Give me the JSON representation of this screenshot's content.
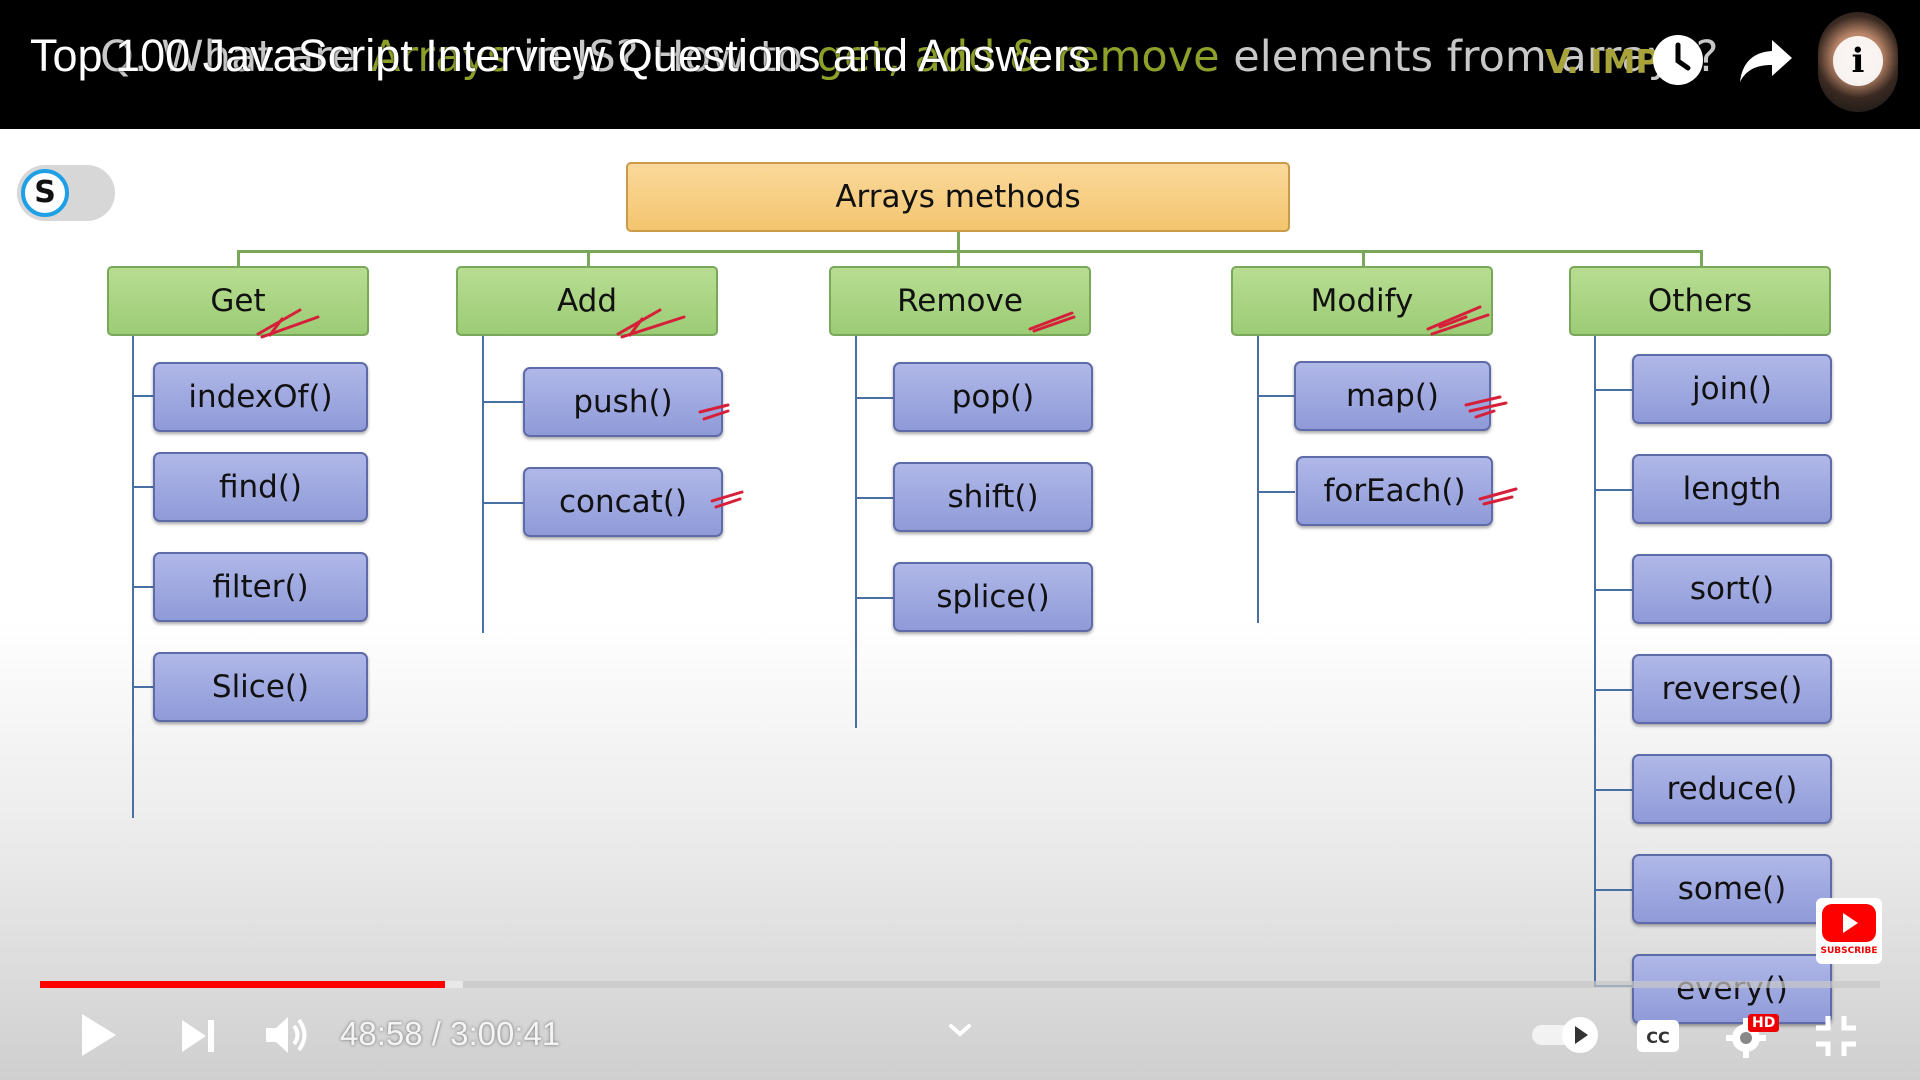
{
  "video": {
    "title": "Top 100 JavaScript Interview Questions and Answers",
    "time_current": "48:58",
    "time_separator": " / ",
    "time_total": "3:00:41",
    "progress_played": 0.22,
    "progress_loaded": 0.23
  },
  "slide": {
    "question_prefix": "Q. What are ",
    "question_hl1": "Arrays",
    "question_mid": " in JS? How to ",
    "question_hl2": "get, add & remove",
    "question_suffix": " elements from arrays?",
    "tag": "V. IMP.",
    "toggle_letter": "S"
  },
  "diagram": {
    "root": "Arrays methods",
    "categories": [
      {
        "label": "Get",
        "methods": [
          "indexOf()",
          "find()",
          "filter()",
          "Slice()"
        ]
      },
      {
        "label": "Add",
        "methods": [
          "push()",
          "concat()"
        ]
      },
      {
        "label": "Remove",
        "methods": [
          "pop()",
          "shift()",
          "splice()"
        ]
      },
      {
        "label": "Modify",
        "methods": [
          "map()",
          "forEach()"
        ]
      },
      {
        "label": "Others",
        "methods": [
          "join()",
          "length",
          "sort()",
          "reverse()",
          "reduce()",
          "some()",
          "every()"
        ]
      }
    ]
  },
  "controls": {
    "hd_badge": "HD",
    "subscribe_label": "SUBSCRIBE",
    "cc_label": "CC"
  },
  "colors": {
    "progress_played": "#ff0000",
    "root_box": "#f3c56f",
    "category_box": "#9ccc76",
    "method_box": "#8f9ad8",
    "annotation_ink": "#d6203a"
  },
  "icons": [
    "watch-later-icon",
    "share-icon",
    "info-icon",
    "play-icon",
    "next-icon",
    "volume-icon",
    "chevron-down-icon",
    "autoplay-toggle-icon",
    "captions-icon",
    "settings-icon",
    "exit-fullscreen-icon",
    "subscribe-icon"
  ]
}
